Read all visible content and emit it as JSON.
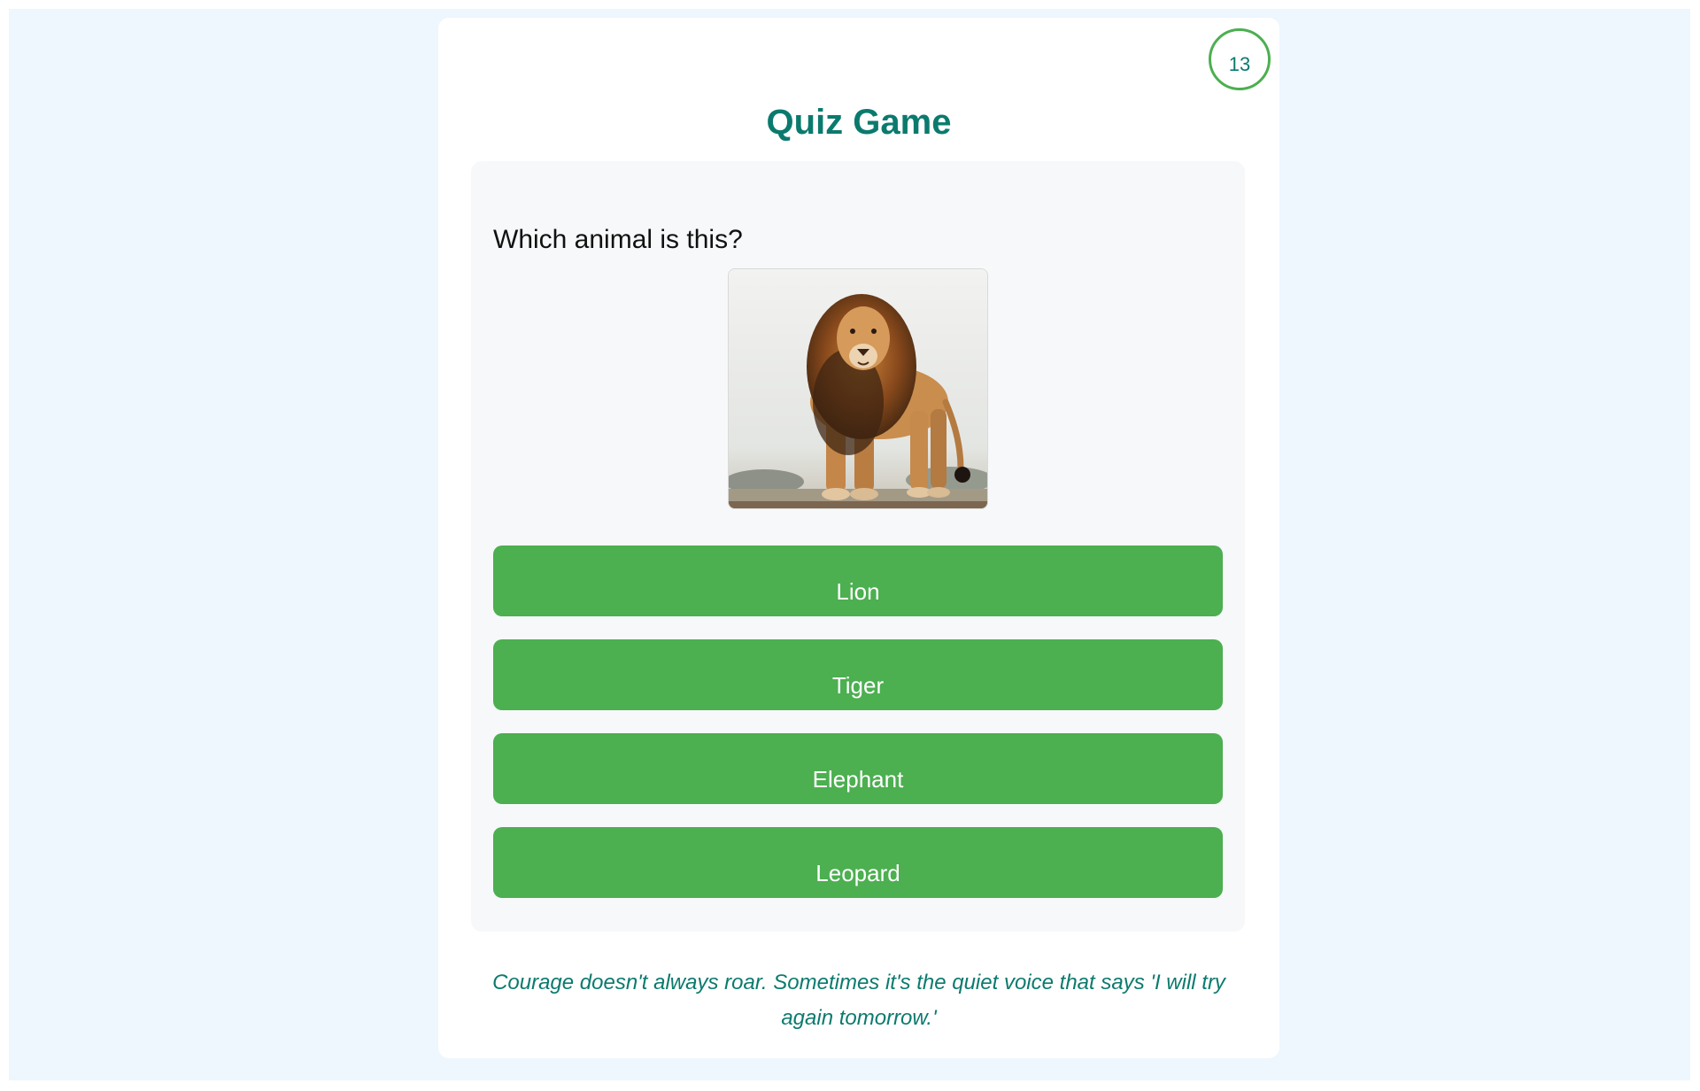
{
  "timer": {
    "seconds_left": "13"
  },
  "header": {
    "title": "Quiz Game"
  },
  "question": {
    "text": "Which animal is this?",
    "image_subject": "lion-photo"
  },
  "answers": [
    {
      "label": "Lion"
    },
    {
      "label": "Tiger"
    },
    {
      "label": "Elephant"
    },
    {
      "label": "Leopard"
    }
  ],
  "quote": {
    "text": "Courage doesn't always roar. Sometimes it's the quiet voice that says 'I will try again tomorrow.'"
  },
  "colors": {
    "accent": "#0b7a6e",
    "button": "#4caf50",
    "page_bg": "#eef6fe",
    "panel_bg": "#f6f8fa"
  }
}
